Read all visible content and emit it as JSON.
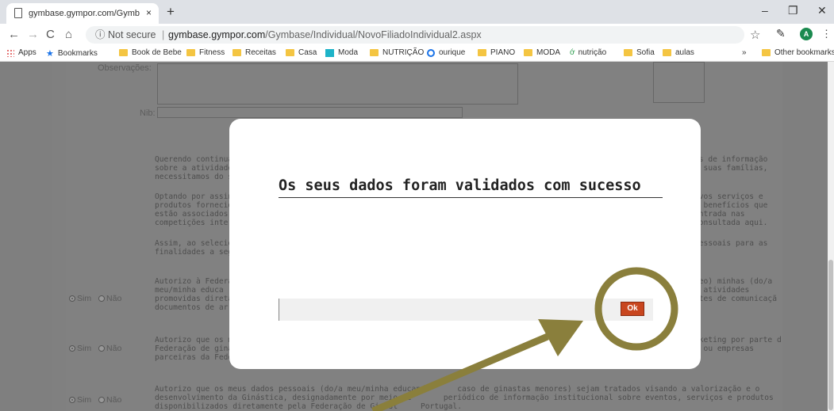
{
  "browser": {
    "tab_title": "gymbase.gympor.com/Gymbase",
    "tab_close": "×",
    "new_tab": "+",
    "win_min": "–",
    "win_max": "❐",
    "win_close": "✕",
    "back": "←",
    "forward": "→",
    "reload": "C",
    "home": "⌂",
    "info_icon": "ⓘ",
    "not_secure": "Not secure",
    "url_host": "gymbase.gympor.com",
    "url_path": "/Gymbase/Individual/NovoFiliadoIndividual2.aspx",
    "bookmark_star": "☆",
    "profile_initial": "A",
    "menu": "⋮",
    "extension": "✎"
  },
  "bookmarks": {
    "apps": "Apps",
    "items": [
      "Bookmarks",
      "Book de Bebe",
      "Fitness",
      "Receitas",
      "Casa",
      "Moda",
      "NUTRIÇÃO",
      "ourique",
      "PIANO",
      "MODA",
      "nutrição",
      "Sofia",
      "aulas"
    ],
    "overflow": "»",
    "other": "Other bookmarks"
  },
  "form": {
    "observacoes_label": "Observações:",
    "nib_label": "Nib:",
    "para1": "Querendo continua\nsobre a atividade\nnecessitamos do s",
    "para1_right": "es de informação\ne suas famílias,",
    "para2": "Optando por assin\nprodutos fornecid\nestão associados \ncompetições inter",
    "para2_right": "ovos serviços e\ns benefícios que\nentrada nas\nconsultada aqui.",
    "para3": "Assim, ao selecion\nfinalidades a segu",
    "para3_right": "pessoais para as",
    "consent1": "Autorizo à Federaç\nmeu/minha educa\npromovidas direta\ndocumentos de ar",
    "consent1_right": "deo) minhas (do/a\ns atividades\nrtes de comunicaçã",
    "consent2": "Autorizo que os m\nFederação de giná\nparceiras da Feder",
    "consent2_right": "rketing por parte d\ns ou empresas",
    "consent3": "Autorizo que os meus dados pessoais (do/a meu/minha educando      caso de ginastas menores) sejam tratados visando a valorização e o\ndesenvolvimento da Ginástica, designadamente por meio de       periódico de informação institucional sobre eventos, serviços e produtos\ndisponibilizados diretamente pela Federação de Ginást     Portugal.",
    "sim": "Sim",
    "nao": "Não"
  },
  "modal": {
    "title": "Os seus dados foram validados com sucesso",
    "ok_label": "Ok"
  },
  "colors": {
    "annotation": "#8a7f3c",
    "ok_button": "#c8461f"
  }
}
